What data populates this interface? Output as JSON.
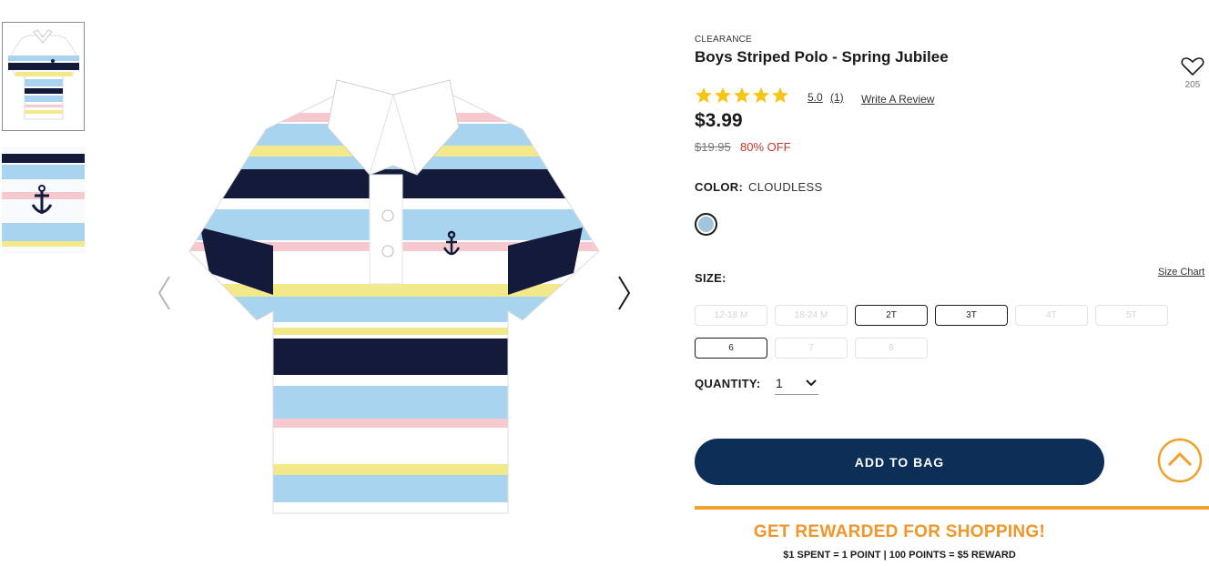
{
  "product": {
    "eyebrow": "CLEARANCE",
    "title": "Boys Striped Polo - Spring Jubilee",
    "favorite_count": "205",
    "rating": {
      "value": "5.0",
      "count": "(1)",
      "stars": 5,
      "write_review": "Write A Review"
    },
    "price": "$3.99",
    "original_price": "$19.95",
    "discount": "80% OFF"
  },
  "color": {
    "label": "COLOR:",
    "value": "CLOUDLESS",
    "swatch_color": "#9fc6dc"
  },
  "size": {
    "label": "SIZE:",
    "chart_link": "Size Chart",
    "options": [
      {
        "label": "12-18 M",
        "available": false
      },
      {
        "label": "18-24 M",
        "available": false
      },
      {
        "label": "2T",
        "available": true
      },
      {
        "label": "3T",
        "available": true
      },
      {
        "label": "4T",
        "available": false
      },
      {
        "label": "5T",
        "available": false
      },
      {
        "label": "6",
        "available": true
      },
      {
        "label": "7",
        "available": false
      },
      {
        "label": "8",
        "available": false
      }
    ]
  },
  "quantity": {
    "label": "QUANTITY:",
    "value": "1"
  },
  "actions": {
    "add_to_bag": "ADD TO BAG"
  },
  "rewards": {
    "title": "GET REWARDED FOR SHOPPING!",
    "subtitle": "$1 SPENT = 1 POINT | 100 POINTS = $5 REWARD"
  },
  "colors": {
    "brand_navy": "#0d2f57",
    "accent_orange": "#f0a12c",
    "sale_red": "#c0392b",
    "star_yellow": "#f5c518",
    "stripe_blue": "#a9d4ef",
    "stripe_yellow": "#f2e98a",
    "stripe_pink": "#f6c9cf",
    "stripe_navy": "#141b3a"
  },
  "icons": [
    "heart-icon",
    "star-icon",
    "chevron-left-icon",
    "chevron-right-icon",
    "chevron-down-icon",
    "chevron-up-icon",
    "anchor-icon"
  ]
}
